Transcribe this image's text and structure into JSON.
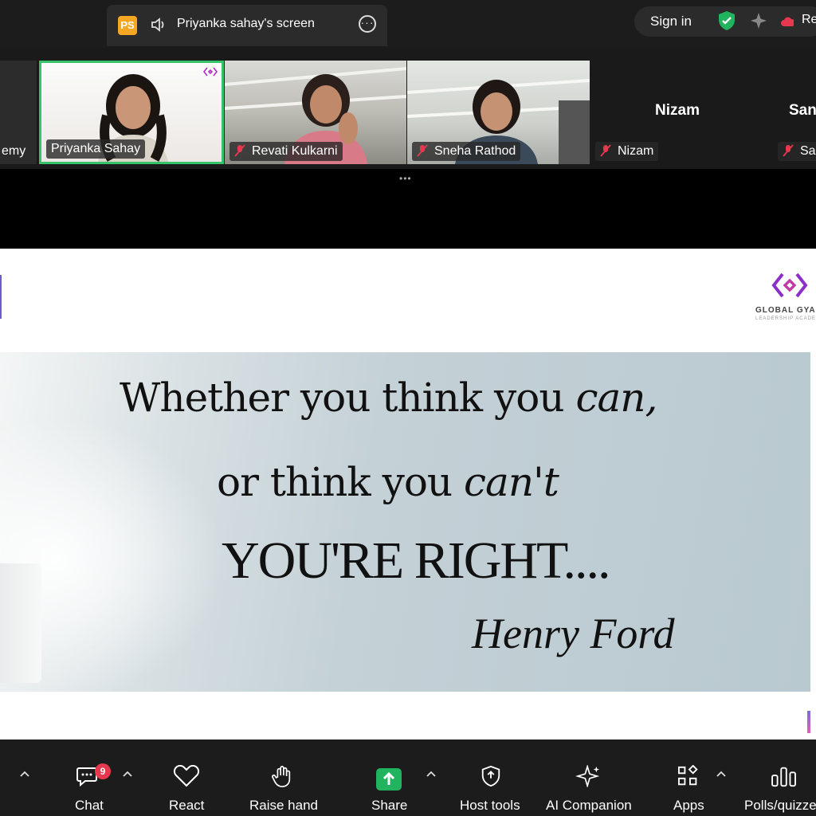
{
  "share": {
    "initials": "PS",
    "title": "Priyanka sahay's screen"
  },
  "top_right": {
    "signin": "Sign in",
    "record_label": "Re"
  },
  "participants": [
    {
      "name": "emy"
    },
    {
      "name": "Priyanka Sahay"
    },
    {
      "name": "Revati Kulkarni"
    },
    {
      "name": "Sneha Rathod"
    },
    {
      "name": "Nizam",
      "center_name": "Nizam"
    },
    {
      "name": "Sa",
      "center_name": "San"
    }
  ],
  "slide": {
    "logo_text": "GLOBAL GYA",
    "logo_sub": "LEADERSHIP ACADE",
    "line1_a": "Whether you think you ",
    "line1_b": "can,",
    "line2_a": "or think you ",
    "line2_b": "can't",
    "line3": "YOU'RE RIGHT....",
    "author": "Henry Ford"
  },
  "toolbar": {
    "chat": "Chat",
    "chat_badge": "9",
    "react": "React",
    "raise": "Raise hand",
    "share": "Share",
    "host": "Host tools",
    "ai": "AI Companion",
    "apps": "Apps",
    "polls": "Polls/quizzes"
  },
  "colors": {
    "active_border": "#35c46a",
    "share_green": "#22b35e",
    "badge_red": "#e8384f",
    "logo_purple": "#8b2fc9"
  }
}
